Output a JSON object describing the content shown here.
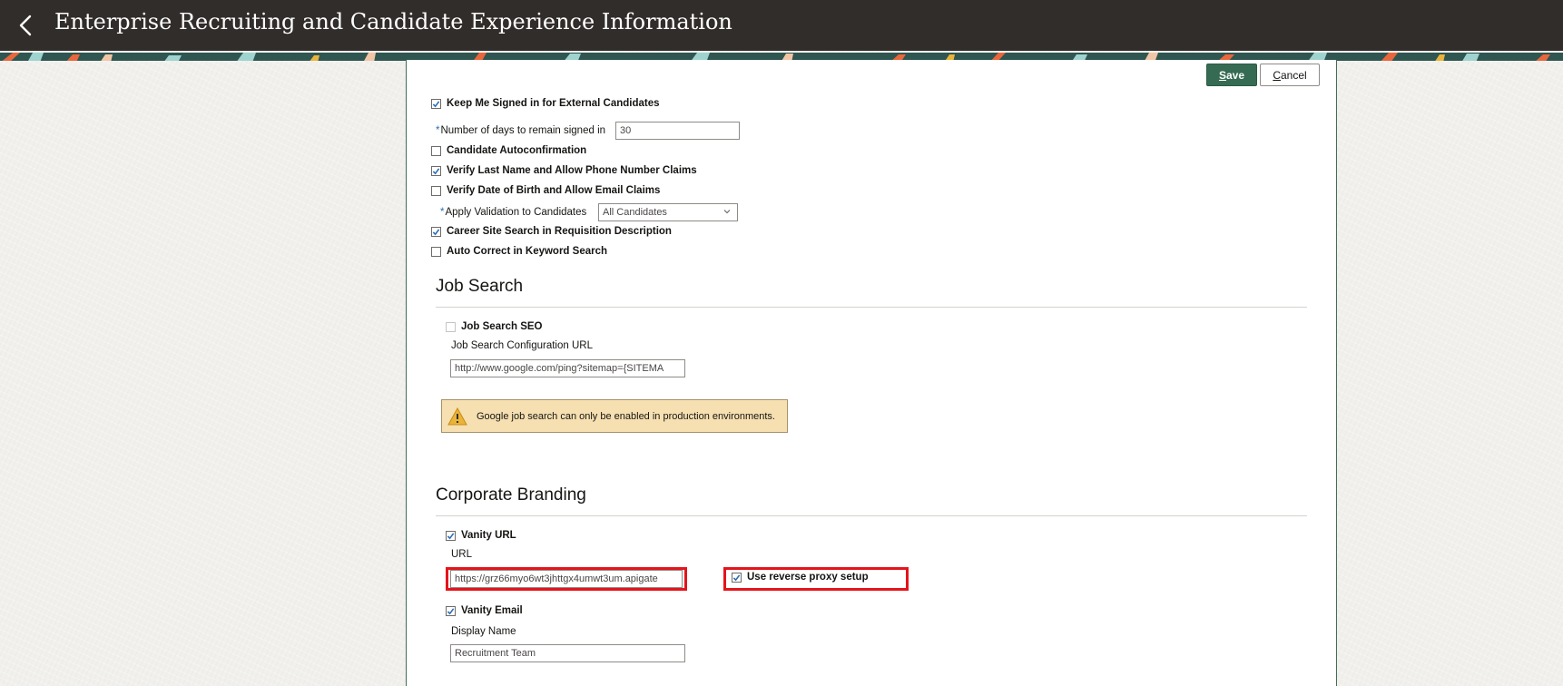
{
  "header": {
    "title": "Enterprise Recruiting and Candidate Experience Information"
  },
  "toolbar": {
    "save_label": "Save",
    "save_underline": "S",
    "save_rest": "ave",
    "cancel_underline": "C",
    "cancel_rest": "ancel"
  },
  "settings": {
    "keep_signed_in": {
      "label": "Keep Me Signed in for External Candidates",
      "checked": true
    },
    "days_signed_in": {
      "required_mark": "*",
      "label": "Number of days to remain signed in",
      "value": "30"
    },
    "candidate_autoconfirmation": {
      "label": "Candidate Autoconfirmation",
      "checked": false
    },
    "verify_last_name": {
      "label": "Verify Last Name and Allow Phone Number Claims",
      "checked": true
    },
    "verify_dob": {
      "label": "Verify Date of Birth and Allow Email Claims",
      "checked": false
    },
    "apply_validation": {
      "required_mark": "*",
      "label": "Apply Validation to Candidates",
      "value": "All Candidates"
    },
    "career_site_search": {
      "label": "Career Site Search in Requisition Description",
      "checked": true
    },
    "auto_correct": {
      "label": "Auto Correct in Keyword Search",
      "checked": false
    }
  },
  "job_search": {
    "title": "Job Search",
    "seo": {
      "label": "Job Search SEO",
      "checked": false,
      "disabled": true
    },
    "config_url_label": "Job Search Configuration URL",
    "config_url_value": "http://www.google.com/ping?sitemap={SITEMA",
    "warning_text": "Google job search can only be enabled in production environments."
  },
  "corporate_branding": {
    "title": "Corporate Branding",
    "vanity_url": {
      "label": "Vanity URL",
      "checked": true
    },
    "url_label": "URL",
    "url_value": "https://grz66myo6wt3jhttgx4umwt3um.apigate",
    "reverse_proxy": {
      "label": "Use reverse proxy setup",
      "checked": true
    },
    "vanity_email": {
      "label": "Vanity Email",
      "checked": true
    },
    "display_name_label": "Display Name",
    "display_name_value": "Recruitment Team"
  },
  "colors": {
    "header_bg": "#312d2a",
    "save_button": "#366b53",
    "highlight": "#e4141b",
    "warning_bg": "#f6dfb0",
    "required_mark": "#2e6cb5"
  }
}
